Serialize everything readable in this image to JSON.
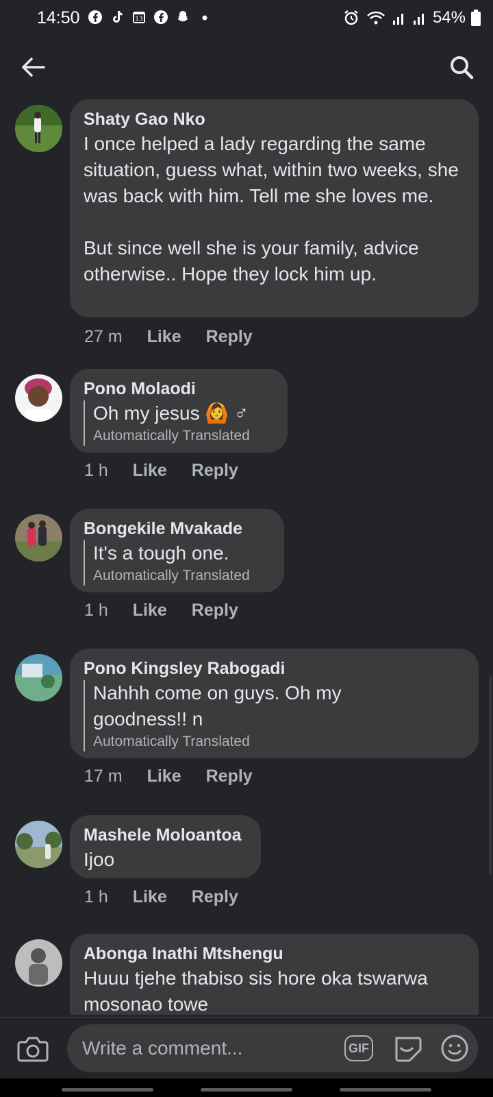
{
  "status_bar": {
    "time": "14:50",
    "battery": "54%",
    "left_icons": [
      "facebook-icon",
      "tiktok-icon",
      "calendar-icon",
      "facebook-icon",
      "snapchat-icon",
      "dot-icon"
    ],
    "right_icons": [
      "alarm-icon",
      "wifi-icon",
      "signal-icon",
      "signal-icon",
      "battery-icon"
    ]
  },
  "app_bar": {
    "back_icon": "arrow-left-icon",
    "search_icon": "search-icon"
  },
  "comments": [
    {
      "author": "Shaty Gao Nko",
      "text": "I once helped a lady regarding the same situation, guess what, within two weeks, she was back with him. Tell me she loves me.\n\nBut since well she is your family, advice otherwise.. Hope they lock him up.",
      "translated": false,
      "time": "27 m",
      "like": "Like",
      "reply": "Reply"
    },
    {
      "author": "Pono Molaodi",
      "text": "Oh my jesus 🙆 ♂",
      "translated": true,
      "translated_label": "Automatically Translated",
      "time": "1 h",
      "like": "Like",
      "reply": "Reply"
    },
    {
      "author": "Bongekile Mvakade",
      "text": "It's a tough one.",
      "translated": true,
      "translated_label": "Automatically Translated",
      "time": "1 h",
      "like": "Like",
      "reply": "Reply"
    },
    {
      "author": "Pono Kingsley Rabogadi",
      "text": "Nahhh come on guys. Oh my goodness!! n",
      "translated": true,
      "translated_label": "Automatically Translated",
      "time": "17 m",
      "like": "Like",
      "reply": "Reply"
    },
    {
      "author": "Mashele Moloantoa",
      "text": "Ijoo",
      "translated": false,
      "time": "1 h",
      "like": "Like",
      "reply": "Reply"
    },
    {
      "author": "Abonga Inathi Mtshengu",
      "text": "Huuu tjehe thabiso sis hore oka tswarwa mosonao towe",
      "translated": false
    }
  ],
  "composer": {
    "placeholder": "Write a comment...",
    "gif_label": "GIF",
    "camera_icon": "camera-icon",
    "sticker_icon": "sticker-icon",
    "emoji_icon": "emoji-icon"
  },
  "colors": {
    "background": "#232427",
    "bubble": "#3a3b3c",
    "primary_text": "#e4e6eb",
    "secondary_text": "#b0b3b8"
  }
}
